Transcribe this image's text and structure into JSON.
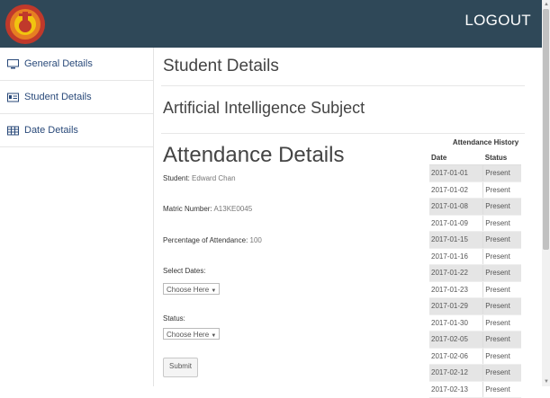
{
  "header": {
    "logout_label": "LOGOUT",
    "bg": "#2f4858"
  },
  "sidebar": {
    "items": [
      {
        "label": "General Details",
        "icon": "monitor-icon"
      },
      {
        "label": "Student Details",
        "icon": "id-card-icon"
      },
      {
        "label": "Date Details",
        "icon": "table-icon"
      }
    ]
  },
  "main": {
    "page_title": "Student Details",
    "subject_title": "Artificial Intelligence Subject",
    "section_title": "Attendance Details",
    "student_label": "Student:",
    "student_value": "Edward Chan",
    "matric_label": "Matric Number:",
    "matric_value": "A13KE0045",
    "percentage_label": "Percentage of Attendance:",
    "percentage_value": "100",
    "select_dates_label": "Select Dates:",
    "select_dates_value": "Choose Here",
    "status_label": "Status:",
    "status_value": "Choose Here",
    "submit_label": "Submit"
  },
  "history": {
    "caption": "Attendance History",
    "columns": [
      "Date",
      "Status"
    ],
    "rows": [
      [
        "2017-01-01",
        "Present"
      ],
      [
        "2017-01-02",
        "Present"
      ],
      [
        "2017-01-08",
        "Present"
      ],
      [
        "2017-01-09",
        "Present"
      ],
      [
        "2017-01-15",
        "Present"
      ],
      [
        "2017-01-16",
        "Present"
      ],
      [
        "2017-01-22",
        "Present"
      ],
      [
        "2017-01-23",
        "Present"
      ],
      [
        "2017-01-29",
        "Present"
      ],
      [
        "2017-01-30",
        "Present"
      ],
      [
        "2017-02-05",
        "Present"
      ],
      [
        "2017-02-06",
        "Present"
      ],
      [
        "2017-02-12",
        "Present"
      ],
      [
        "2017-02-13",
        "Present"
      ]
    ]
  }
}
